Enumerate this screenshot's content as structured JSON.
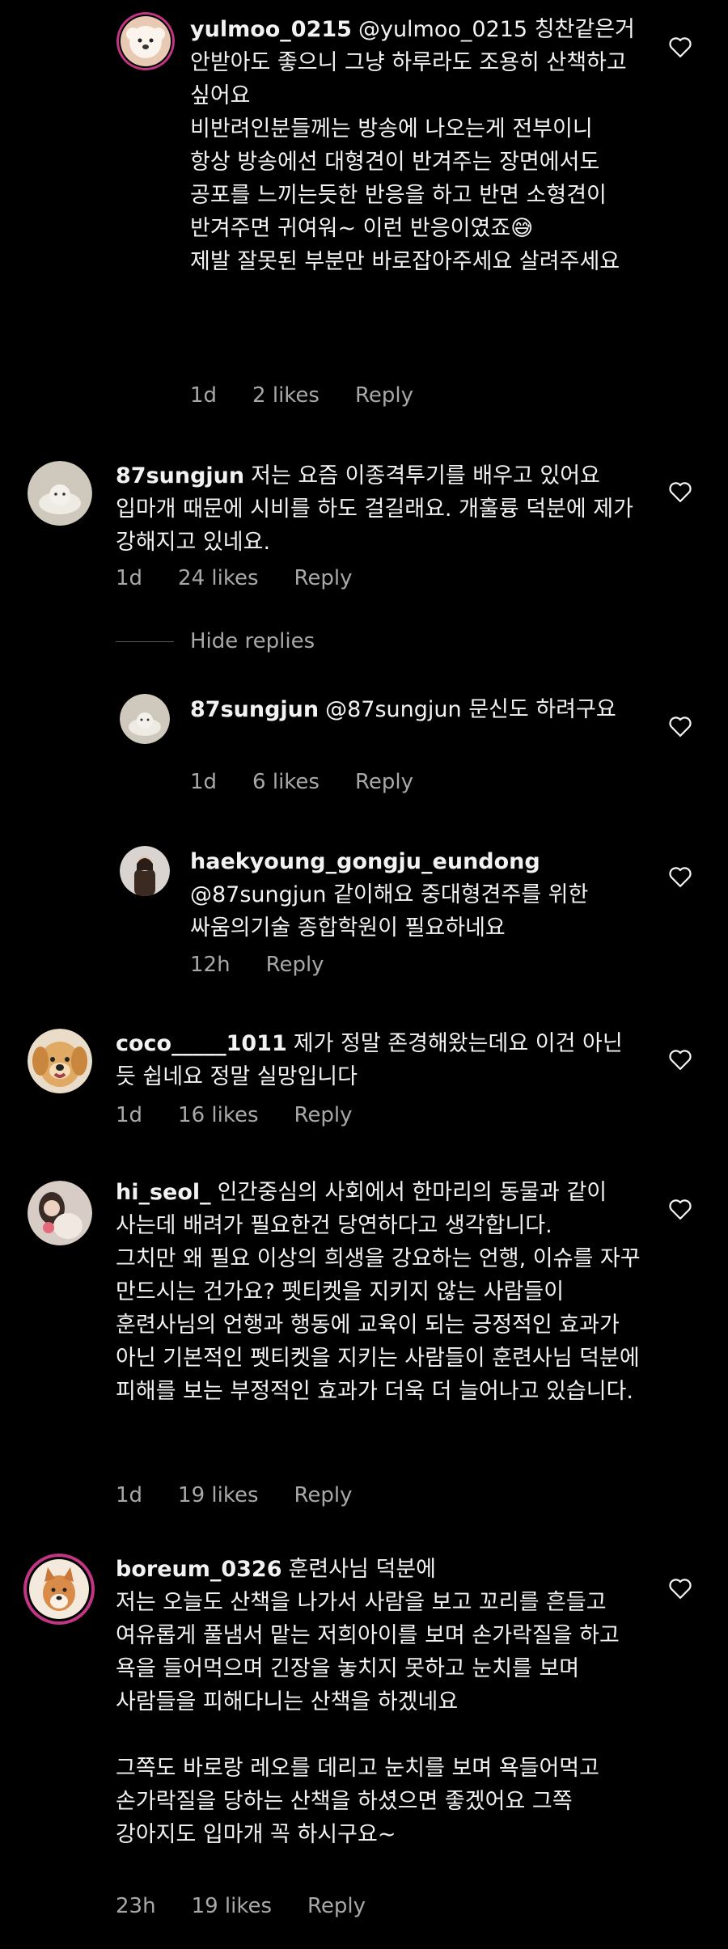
{
  "colors": {
    "background": "#000000",
    "text": "#f2f2f2",
    "meta": "#a8a8a8",
    "story_ring": "#c13584"
  },
  "icons": {
    "like": "heart-outline-icon"
  },
  "hide_replies_label": "Hide replies",
  "comments": [
    {
      "username": "yulmoo_0215",
      "lines": [
        "@yulmoo_0215 칭찬같은거 안받아도 좋으니 그냥 하루라도 조용히 산책하고 싶어요",
        "비반려인분들께는 방송에 나오는게 전부이니",
        "항상 방송에선 대형견이 반겨주는 장면에서도 공포를 느끼는듯한 반응을 하고 반면 소형견이 반겨주면 귀여워~ 이런 반응이였죠😅",
        "제발 잘못된 부분만 바로잡아주세요 살려주세요"
      ],
      "time": "1d",
      "likes": "2 likes",
      "reply": "Reply"
    },
    {
      "username": "87sungjun",
      "lines": [
        "저는 요즘 이종격투기를 배우고 있어요 입마개 때문에 시비를 하도 걸길래요. 개훌륭 덕분에 제가 강해지고 있네요."
      ],
      "time": "1d",
      "likes": "24 likes",
      "reply": "Reply"
    },
    {
      "username": "87sungjun",
      "lines": [
        "@87sungjun 문신도 하려구요"
      ],
      "time": "1d",
      "likes": "6 likes",
      "reply": "Reply"
    },
    {
      "username": "haekyoung_gongju_eundong",
      "lines": [
        "@87sungjun 같이해요 중대형견주를 위한 싸움의기술 종합학원이 필요하네요"
      ],
      "time": "12h",
      "likes": "",
      "reply": "Reply"
    },
    {
      "username": "coco_____1011",
      "lines": [
        "제가 정말 존경해왔는데요 이건 아닌 듯 쉽네요 정말 실망입니다"
      ],
      "time": "1d",
      "likes": "16 likes",
      "reply": "Reply"
    },
    {
      "username": "hi_seol_",
      "lines": [
        "인간중심의 사회에서 한마리의 동물과 같이 사는데 배려가 필요한건 당연하다고 생각합니다.",
        "그치만 왜 필요 이상의 희생을 강요하는 언행, 이슈를 자꾸 만드시는 건가요? 펫티켓을 지키지 않는 사람들이 훈련사님의 언행과 행동에 교육이 되는 긍정적인 효과가 아닌 기본적인 펫티켓을 지키는 사람들이 훈련사님 덕분에 피해를 보는 부정적인 효과가 더욱 더 늘어나고 있습니다."
      ],
      "time": "1d",
      "likes": "19 likes",
      "reply": "Reply"
    },
    {
      "username": "boreum_0326",
      "lines": [
        "훈련사님 덕분에",
        "저는 오늘도 산책을 나가서 사람을 보고 꼬리를 흔들고 여유롭게 풀냄서 맡는 저희아이를 보며 손가락질을 하고 욕을 들어먹으며 긴장을 놓치지 못하고 눈치를 보며 사람들을 피해다니는 산책을 하겠네요",
        "",
        "그쪽도 바로랑 레오를 데리고 눈치를 보며 욕들어먹고 손가락질을 당하는 산책을 하셨으면 좋겠어요 그쪽 강아지도 입마개 꼭 하시구요~"
      ],
      "time": "23h",
      "likes": "19 likes",
      "reply": "Reply"
    }
  ]
}
